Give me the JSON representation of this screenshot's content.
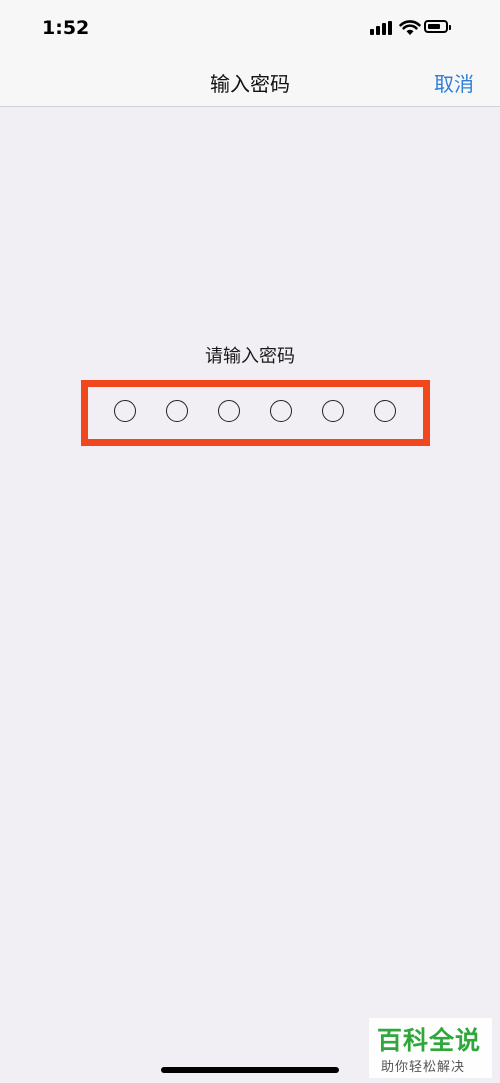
{
  "status_bar": {
    "time": "1:52"
  },
  "nav": {
    "title": "输入密码",
    "cancel_label": "取消"
  },
  "passcode": {
    "prompt": "请输入密码",
    "length": 6,
    "filled": 0
  },
  "colors": {
    "highlight_frame": "#f0471f",
    "accent": "#2f7fd6",
    "background": "#f1eff4"
  },
  "watermark": {
    "title": "百科全说",
    "subtitle": "助你轻松解决"
  }
}
